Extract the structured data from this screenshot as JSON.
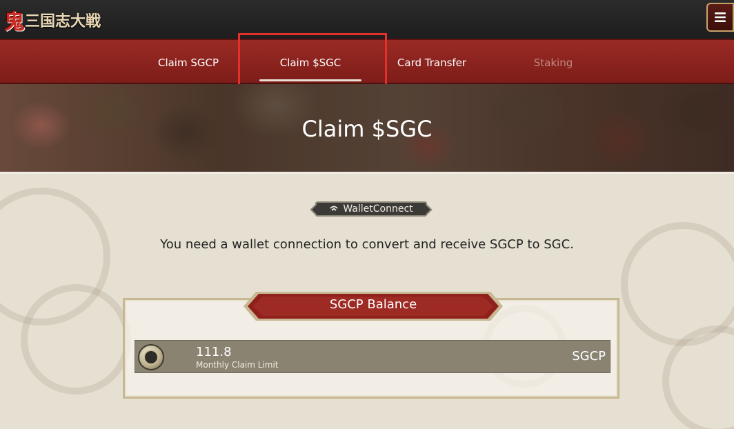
{
  "header": {
    "logo_text": "三国志大戦",
    "logo_mark": "鬼",
    "menu_icon": "hamburger-icon"
  },
  "nav": {
    "tabs": [
      {
        "label": "Claim SGCP",
        "active": false,
        "disabled": false
      },
      {
        "label": "Claim $SGC",
        "active": true,
        "disabled": false
      },
      {
        "label": "Card Transfer",
        "active": false,
        "disabled": false
      },
      {
        "label": "Staking",
        "active": false,
        "disabled": true
      }
    ]
  },
  "hero": {
    "title": "Claim $SGC"
  },
  "wallet": {
    "button_label": "WalletConnect",
    "icon": "walletconnect-icon",
    "message": "You need a wallet connection to convert and receive SGCP to SGC."
  },
  "balance": {
    "title": "SGCP Balance",
    "value": "111.8",
    "sub_label": "Monthly Claim Limit",
    "unit": "SGCP"
  },
  "colors": {
    "nav_red": "#8e2520",
    "highlight": "#e3302b",
    "panel_border": "#c7b892",
    "row_bg": "#8a8372"
  }
}
